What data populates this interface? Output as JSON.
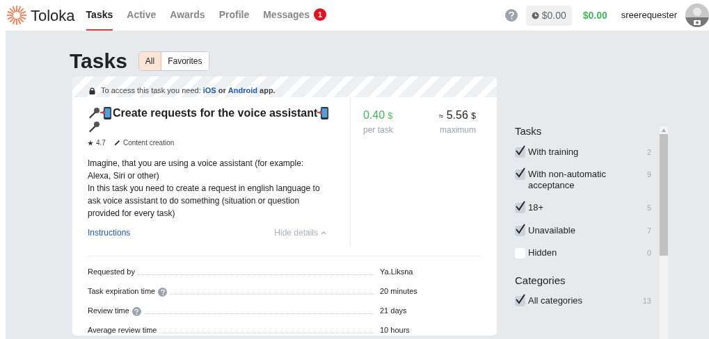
{
  "header": {
    "logo": "Toloka",
    "nav": [
      {
        "label": "Tasks",
        "selected": true
      },
      {
        "label": "Active",
        "selected": false
      },
      {
        "label": "Awards",
        "selected": false
      },
      {
        "label": "Profile",
        "selected": false
      },
      {
        "label": "Messages",
        "selected": false,
        "badge": "1"
      }
    ],
    "pending_balance": "$0.00",
    "balance": "$0.00",
    "username": "sreerequester"
  },
  "page_title": "Tasks",
  "filter_tabs": [
    {
      "label": "All",
      "selected": true
    },
    {
      "label": "Favorites",
      "selected": false
    }
  ],
  "task": {
    "access_note": {
      "prefix": "To access this task you need:",
      "link1": "iOS",
      "middle": "or",
      "link2": "Android",
      "suffix": "app."
    },
    "title": "Create requests for the voice assistant",
    "rating": "4.7",
    "category": "Content creation",
    "description": [
      "Imagine, that you are using a voice assistant (for example: Alexa, Siri or other)",
      "In this task you need to create a request in english language to ask voice assistant to do something (situation or question provided for every task)"
    ],
    "instructions_link": "Instructions",
    "hide_details": "Hide details",
    "price": "0.40",
    "currency": "$",
    "price_caption": "per task",
    "maximum": "5.56",
    "approx": "≈",
    "maximum_caption": "maximum",
    "details": [
      {
        "label": "Requested by",
        "help": false,
        "value": "Ya.Liksna"
      },
      {
        "label": "Task expiration time",
        "help": true,
        "value": "20 minutes"
      },
      {
        "label": "Review time",
        "help": true,
        "value": "21 days"
      },
      {
        "label": "Average review time",
        "help": false,
        "value": "10 hours"
      }
    ]
  },
  "sidebar": {
    "sections": [
      {
        "title": "Tasks",
        "items": [
          {
            "label": "With training",
            "checked": true,
            "count": "2"
          },
          {
            "label": "With non-automatic acceptance",
            "checked": true,
            "count": "9"
          },
          {
            "label": "18+",
            "checked": true,
            "count": "5"
          },
          {
            "label": "Unavailable",
            "checked": true,
            "count": "7"
          },
          {
            "label": "Hidden",
            "checked": false,
            "count": "0"
          }
        ]
      },
      {
        "title": "Categories",
        "items": [
          {
            "label": "All categories",
            "checked": true,
            "count": "13"
          }
        ]
      }
    ]
  }
}
